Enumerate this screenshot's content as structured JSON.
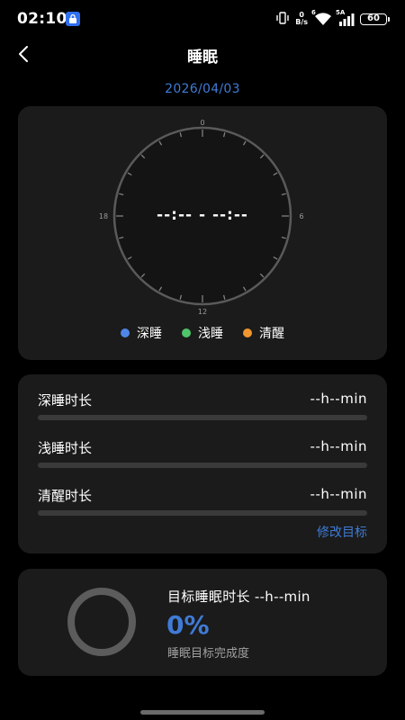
{
  "status_bar": {
    "time": "02:10",
    "net_speed_value": "0",
    "net_speed_unit": "B/s",
    "signal_1": "6",
    "signal_2": "5A",
    "battery": "60"
  },
  "header": {
    "title": "睡眠",
    "date": "2026/04/03"
  },
  "clock": {
    "ticks": {
      "top": "0",
      "right": "6",
      "bottom": "12",
      "left": "18"
    },
    "time_range": "--:-- - --:--"
  },
  "legend": [
    {
      "label": "深睡",
      "color": "#4f86e8"
    },
    {
      "label": "浅睡",
      "color": "#4fc46a"
    },
    {
      "label": "清醒",
      "color": "#f0962e"
    }
  ],
  "durations": [
    {
      "label": "深睡时长",
      "value": "--h--min",
      "progress": 0
    },
    {
      "label": "浅睡时长",
      "value": "--h--min",
      "progress": 0
    },
    {
      "label": "清醒时长",
      "value": "--h--min",
      "progress": 0
    }
  ],
  "edit_goal_label": "修改目标",
  "goal": {
    "title": "目标睡眠时长 --h--min",
    "percent": "0%",
    "subtitle": "睡眠目标完成度"
  },
  "colors": {
    "accent": "#3f7bd6",
    "card": "#1b1b1b",
    "background": "#000000"
  }
}
